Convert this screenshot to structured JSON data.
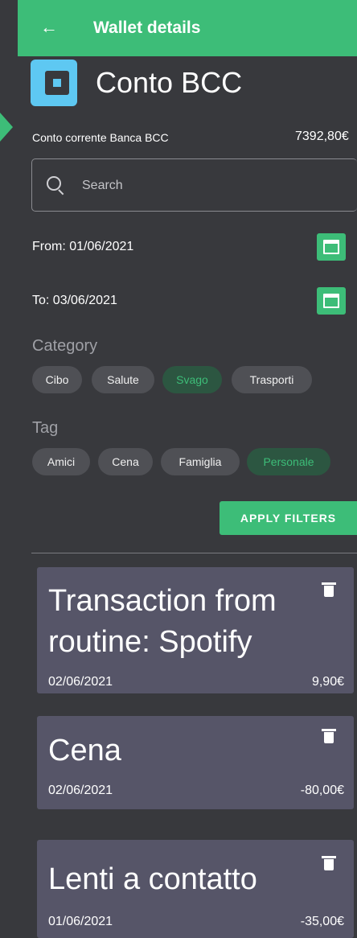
{
  "header": {
    "title": "Wallet details",
    "back_icon": "arrow-left-icon"
  },
  "wallet": {
    "name": "Conto BCC",
    "description": "Conto corrente Banca BCC",
    "balance": "7392,80€",
    "icon": "wallet-icon",
    "icon_color": "#5ec8f2"
  },
  "search": {
    "placeholder": "Search"
  },
  "filters": {
    "from_label": "From: 01/06/2021",
    "to_label": "To: 03/06/2021",
    "category_title": "Category",
    "categories": [
      {
        "label": "Cibo",
        "selected": false
      },
      {
        "label": "Salute",
        "selected": false
      },
      {
        "label": "Svago",
        "selected": true
      },
      {
        "label": "Trasporti",
        "selected": false
      }
    ],
    "tag_title": "Tag",
    "tags": [
      {
        "label": "Amici",
        "selected": false
      },
      {
        "label": "Cena",
        "selected": false
      },
      {
        "label": "Famiglia",
        "selected": false
      },
      {
        "label": "Personale",
        "selected": true
      }
    ],
    "apply_label": "APPLY FILTERS"
  },
  "transactions": [
    {
      "title_line1": "Transaction from",
      "title_line2": "routine: Spotify",
      "date": "02/06/2021",
      "amount": "9,90€"
    },
    {
      "title_line1": "Cena",
      "date": "02/06/2021",
      "amount": "-80,00€"
    },
    {
      "title_line1": "Lenti a contatto",
      "date": "01/06/2021",
      "amount": "-35,00€"
    }
  ],
  "colors": {
    "accent": "#3dbd78",
    "background": "#38393d",
    "card": "#565568",
    "chip": "#4f5055"
  }
}
